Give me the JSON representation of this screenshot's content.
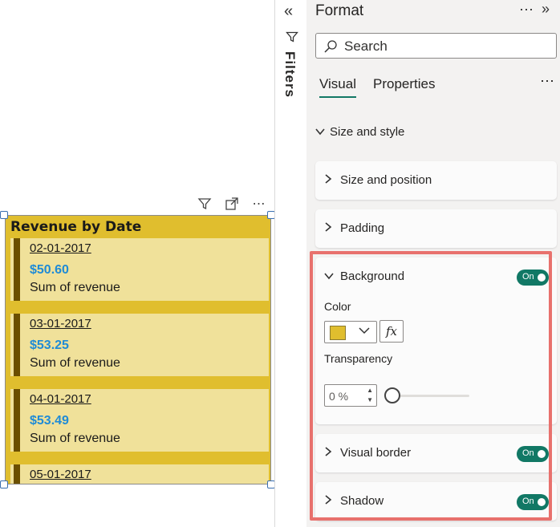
{
  "visual": {
    "title": "Revenue by Date",
    "header_icons": [
      "filter-icon",
      "focus-mode-icon",
      "more-options-icon"
    ],
    "rows": [
      {
        "date": "02-01-2017",
        "value": "$50.60",
        "label": "Sum of revenue"
      },
      {
        "date": "03-01-2017",
        "value": "$53.25",
        "label": "Sum of revenue"
      },
      {
        "date": "04-01-2017",
        "value": "$53.49",
        "label": "Sum of revenue"
      },
      {
        "date": "05-01-2017",
        "value": "",
        "label": ""
      }
    ],
    "colors": {
      "background": "#e0be2e",
      "row": "#f0e19a",
      "accent": "#6b4f00",
      "value": "#1f8bd6"
    }
  },
  "filters": {
    "label": "Filters"
  },
  "pane": {
    "title": "Format",
    "search_placeholder": "Search",
    "tabs": [
      {
        "label": "Visual",
        "active": true
      },
      {
        "label": "Properties",
        "active": false
      }
    ],
    "section": "Size and style",
    "groups": {
      "size_position": {
        "label": "Size and position"
      },
      "padding": {
        "label": "Padding"
      },
      "background": {
        "label": "Background",
        "toggle": "On",
        "color_label": "Color",
        "color_value": "#e0be2e",
        "fx_label": "fx",
        "transparency_label": "Transparency",
        "transparency_value": "0 %",
        "transparency_level": 0
      },
      "visual_border": {
        "label": "Visual border",
        "toggle": "On"
      },
      "shadow": {
        "label": "Shadow",
        "toggle": "On"
      }
    },
    "accent_color": "#117865",
    "highlight_color": "#e8716d"
  }
}
